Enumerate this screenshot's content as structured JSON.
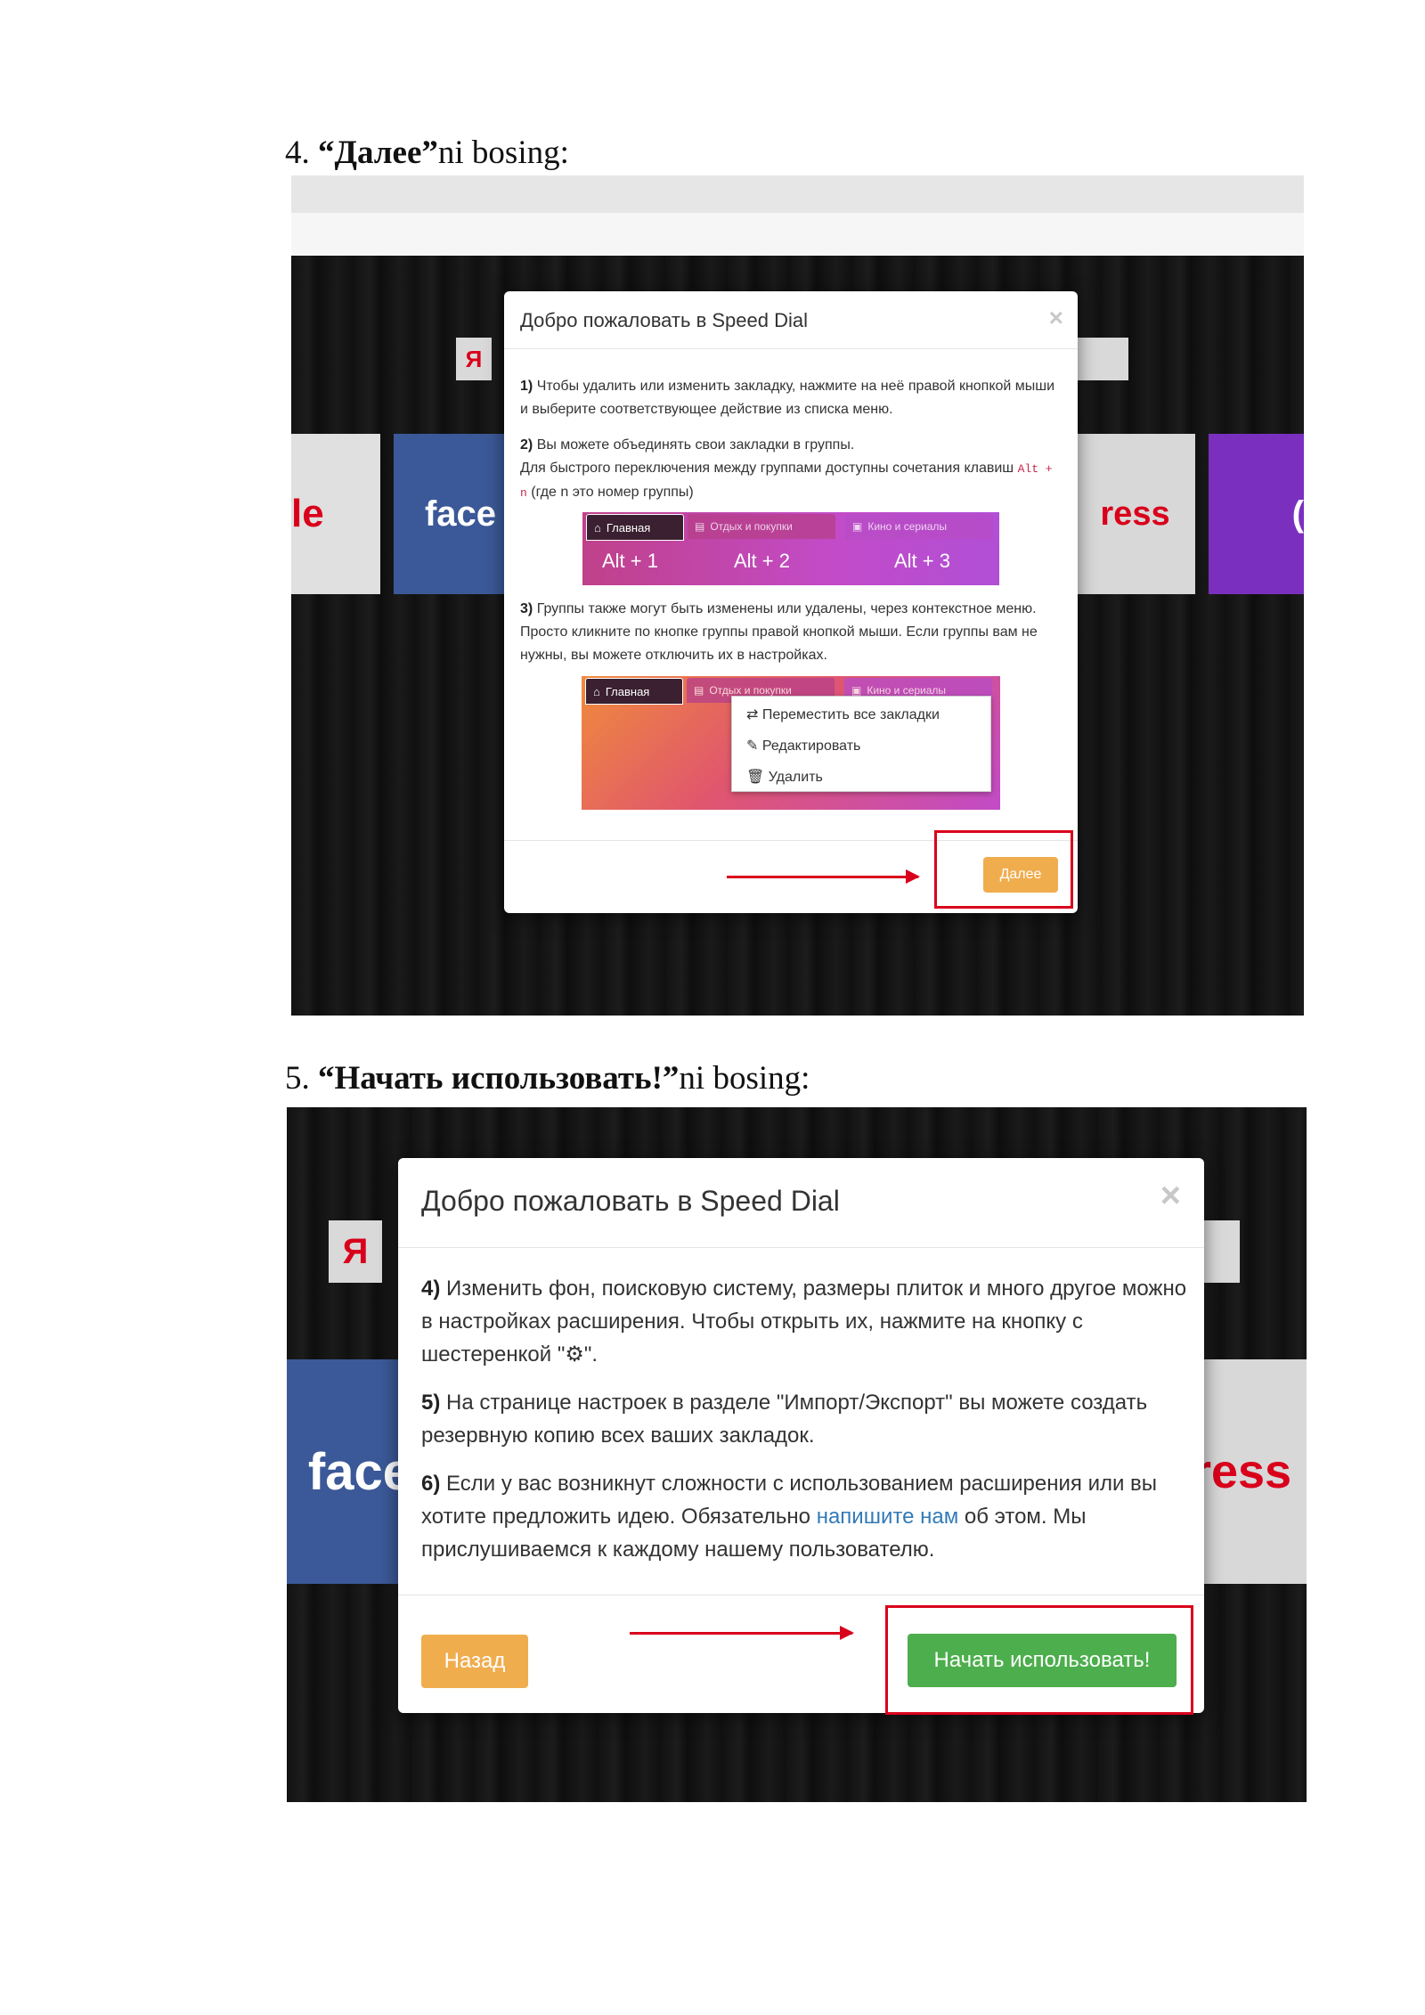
{
  "step4": {
    "number": "4.",
    "bold": "“Далее”",
    "rest": "ni bosing:"
  },
  "step5": {
    "number": "5.",
    "bold": "“Начать использовать!”",
    "rest": "ni bosing:"
  },
  "shot1": {
    "bg_tiles": {
      "yandex": "Я",
      "google": "le",
      "facebook": "face",
      "express": "ress",
      "extra": "("
    },
    "modal": {
      "title": "Добро пожаловать в Speed Dial",
      "close": "×",
      "p1_num": "1)",
      "p1_text": "Чтобы удалить или изменить закладку, нажмите на неё правой кнопкой мыши и выберите соответствующее действие из списка меню.",
      "p2_num": "2)",
      "p2_line1": "Вы можете объединять свои закладки в группы.",
      "p2_line2": "Для быстрого переключения между группами доступны сочетания клавиш",
      "p2_code": "Alt + n",
      "p2_tail": "(где n это номер группы)",
      "p3_num": "3)",
      "p3_text": "Группы также могут быть изменены или удалены, через контекстное меню. Просто кликните по кнопке группы правой кнопкой мыши. Если группы вам не нужны, вы можете отключить их в настройках.",
      "groups": {
        "tab1": "Главная",
        "tab2": "Отдых и покупки",
        "tab3": "Кино и сериалы",
        "hot1": "Alt + 1",
        "hot2": "Alt + 2",
        "hot3": "Alt + 3"
      },
      "context_menu": {
        "item1": "Переместить все закладки",
        "item2": "Редактировать",
        "item3": "Удалить"
      },
      "next_button": "Далее"
    }
  },
  "shot2": {
    "bg_tiles": {
      "yandex": "Я",
      "facebook": "face",
      "express": "ress"
    },
    "modal": {
      "title": "Добро пожаловать в Speed Dial",
      "close": "×",
      "p4_num": "4)",
      "p4_text": "Изменить фон, поисковую систему, размеры плиток и много другое можно в настройках расширения. Чтобы открыть их, нажмите на кнопку с шестеренкой \"⚙\".",
      "p5_num": "5)",
      "p5_text": "На странице настроек в разделе \"Импорт/Экспорт\" вы можете создать резервную копию всех ваших закладок.",
      "p6_num": "6)",
      "p6_before": "Если у вас возникнут сложности с использованием расширения или вы хотите предложить идею. Обязательно",
      "p6_link": "напишите нам",
      "p6_after": "об этом. Мы прислушиваемся к каждому нашему пользователю.",
      "back_button": "Назад",
      "start_button": "Начать использовать!"
    }
  },
  "colors": {
    "accent_red": "#d9001b",
    "btn_orange": "#f0ad4e",
    "btn_green": "#4cae4c",
    "facebook_blue": "#3b5998"
  }
}
